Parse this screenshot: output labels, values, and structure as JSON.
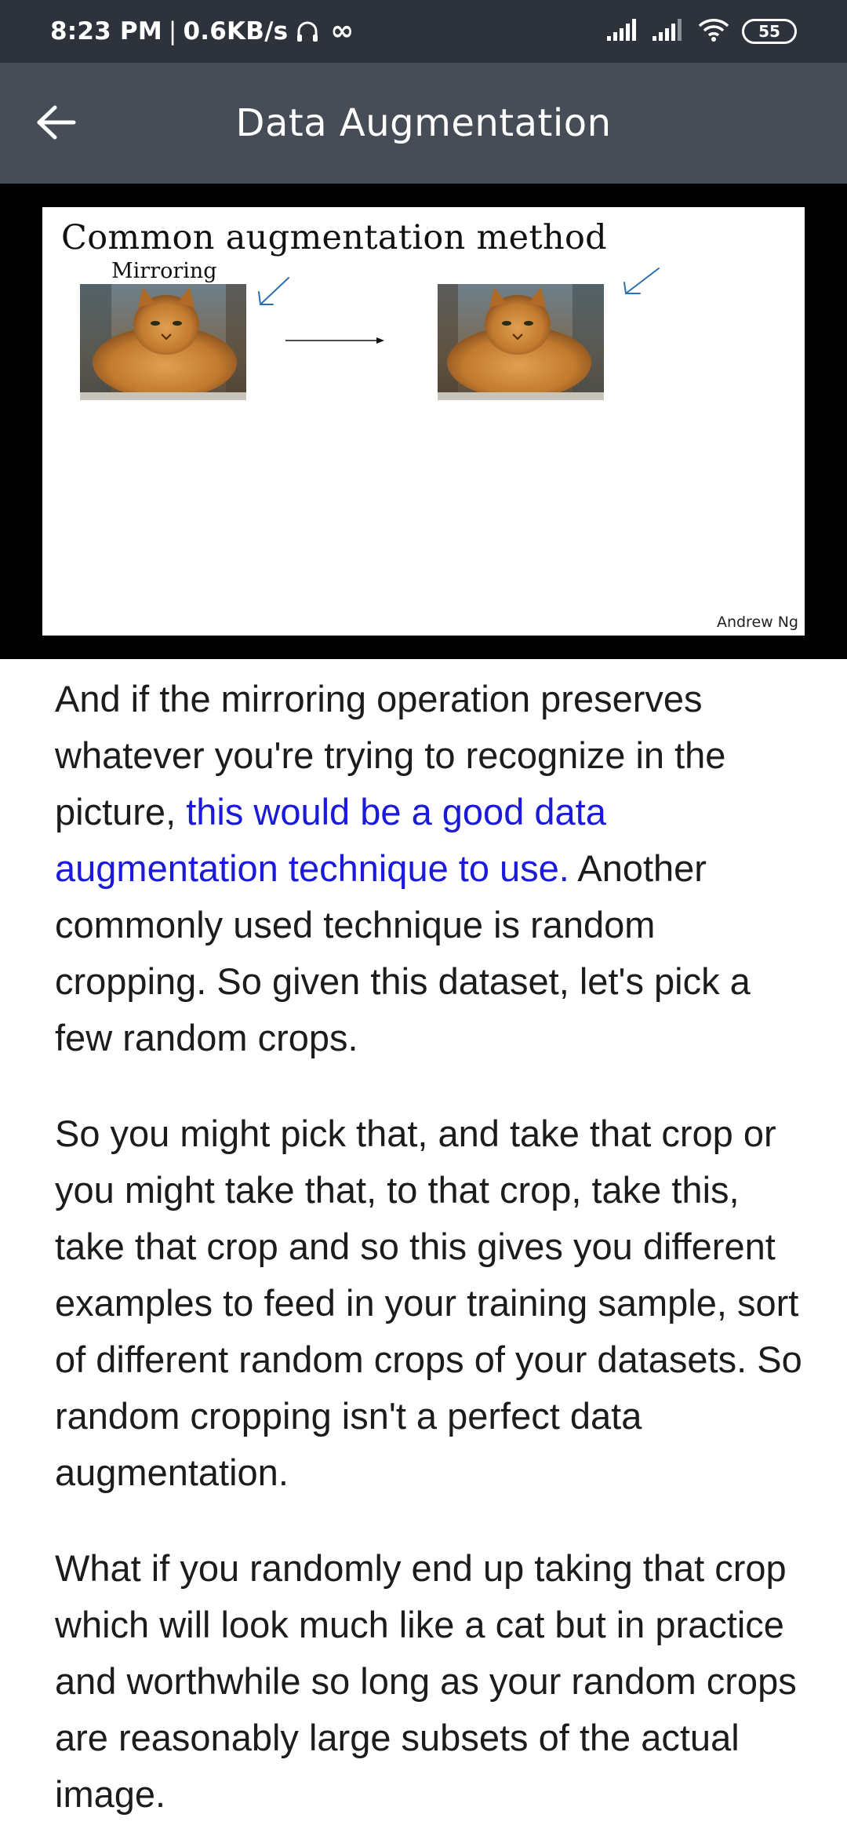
{
  "status_bar": {
    "time": "8:23 PM",
    "network_speed": "0.6KB/s",
    "headphone_icon": "headphone-icon",
    "infinity_symbol": "∞",
    "battery_level": "55"
  },
  "app_bar": {
    "back_icon": "arrow-left-icon",
    "title": "Data Augmentation"
  },
  "slide": {
    "title": "Common augmentation method",
    "subtitle": "Mirroring",
    "credit": "Andrew Ng"
  },
  "transcript": {
    "p1_before": "And if the mirroring operation preserves whatever you're trying to recognize in the picture, ",
    "p1_highlight": "this would be a good data augmentation technique to use.",
    "p1_after": " Another commonly used technique is random cropping. So given this dataset, let's pick a few random crops.",
    "p2": "So you might pick that, and take that crop or you might take that, to that crop, take this, take that crop and so this gives you different examples to feed in your training sample, sort of different random crops of your datasets. So random cropping isn't a perfect data augmentation.",
    "p3": "What if you randomly end up taking that crop which will look much like a cat but in practice and worthwhile so long as your random crops are reasonably large subsets of the actual image."
  },
  "colors": {
    "status_bar_bg": "#2e333b",
    "app_bar_bg": "#474d56",
    "highlight_text": "#1a1ad8"
  }
}
